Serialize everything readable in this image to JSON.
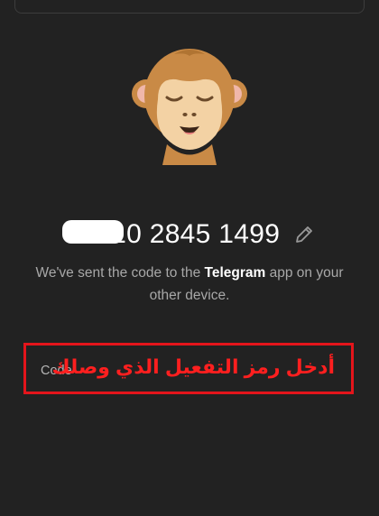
{
  "colors": {
    "background": "#222222",
    "annotation_red": "#e4151b",
    "muted_text": "#a8a8a8"
  },
  "header": {
    "avatar_icon": "monkey-eyes-closed-icon"
  },
  "phone": {
    "number_visible": "+2010 2845 1499",
    "edit_icon": "pencil-icon"
  },
  "info": {
    "text_before": "We've sent the code to the ",
    "app_name": "Telegram",
    "text_after": " app on your other device."
  },
  "code_field": {
    "label": "Code",
    "annotation": "أدخل رمز التفعيل الذي وصلك"
  }
}
